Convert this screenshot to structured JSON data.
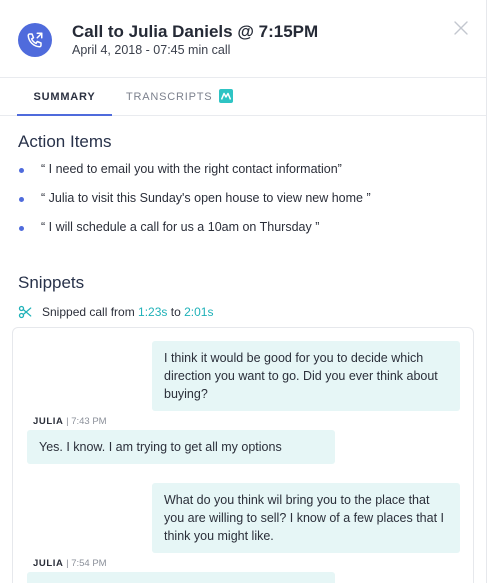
{
  "header": {
    "title": "Call to Julia Daniels @ 7:15PM",
    "subtitle": "April 4, 2018 - 07:45 min call",
    "icon": "phone-outgoing-icon",
    "close_icon": "close-icon",
    "accent": "#4f6bdc"
  },
  "tabs": [
    {
      "label": "SUMMARY",
      "active": true
    },
    {
      "label": "TRANSCRIPTS",
      "active": false,
      "badge_icon": "logo-m-icon"
    }
  ],
  "action_items": {
    "title": "Action Items",
    "items": [
      "“ I need to email you with the right contact information”",
      "“ Julia to visit this Sunday's open house to view new home ”",
      "“  I will schedule a call for us a 10am on Thursday ”"
    ]
  },
  "snippets": {
    "title": "Snippets",
    "prefix": "Snipped call from ",
    "start": "1:23s",
    "joiner": " to ",
    "end": "2:01s",
    "timestamp_color": "#1fb1b8",
    "messages": [
      {
        "direction": "out",
        "text": "I think it would be good for you to decide which direction you want to go. Did you ever think about buying?"
      },
      {
        "direction": "in",
        "speaker": "JULIA",
        "time": " | 7:43 PM",
        "text": "Yes. I know. I am trying to get all my options"
      },
      {
        "direction": "out",
        "text": "What do you think wil bring you to the place that you are willing to sell? I know of a few places that I think you might like."
      },
      {
        "direction": "in",
        "speaker": "JULIA",
        "time": " | 7:54 PM",
        "text": ""
      }
    ]
  }
}
